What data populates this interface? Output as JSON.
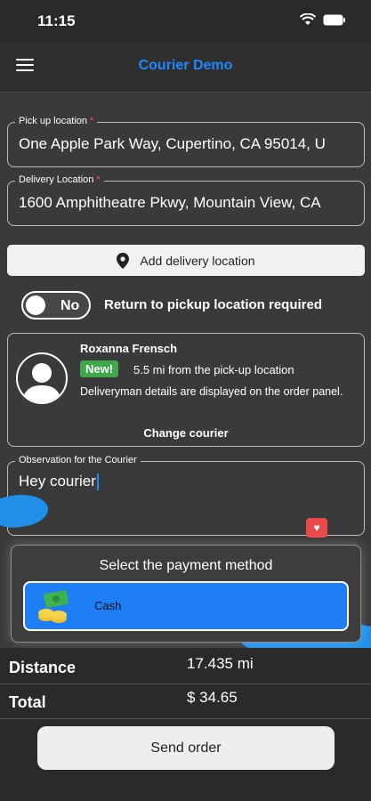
{
  "status": {
    "time": "11:15"
  },
  "nav": {
    "title": "Courier Demo"
  },
  "pickup": {
    "label": "Pick up location",
    "required_mark": "*",
    "value": "One Apple Park Way, Cupertino, CA 95014, U"
  },
  "delivery": {
    "label": "Delivery Location",
    "required_mark": "*",
    "value": "1600 Amphitheatre Pkwy, Mountain View, CA"
  },
  "add_location": {
    "label": "Add delivery location",
    "icon": "map-pin-icon"
  },
  "return_toggle": {
    "state": "No",
    "label": "Return to pickup location required"
  },
  "courier": {
    "name": "Roxanna Frensch",
    "badge": "New!",
    "distance": "5.5 mi from the pick-up location",
    "note": "Deliveryman details are displayed on the order panel.",
    "change_label": "Change courier"
  },
  "observation": {
    "label": "Observation for the Courier",
    "value": "Hey courier"
  },
  "payment": {
    "title": "Select the payment method",
    "option": "Cash",
    "accent": "#1e7ef5"
  },
  "summary": {
    "distance_label": "Distance",
    "distance_value": "17.435 mi",
    "total_label": "Total",
    "total_value": "$ 34.65"
  },
  "send_button": {
    "label": "Send order"
  }
}
